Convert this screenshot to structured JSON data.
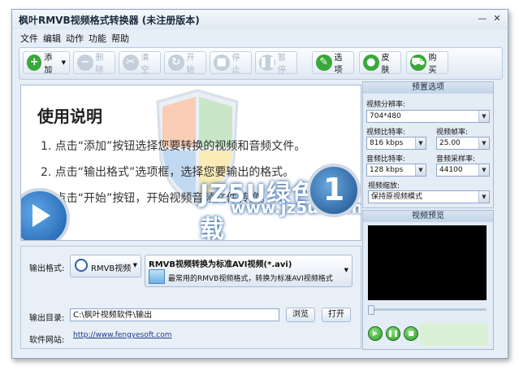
{
  "window": {
    "title": "枫叶RMVB视频格式转换器  (未注册版本)"
  },
  "menu": [
    "文件",
    "编辑",
    "动作",
    "功能",
    "帮助"
  ],
  "toolbar": {
    "add": "添加",
    "delete": "删除",
    "clear": "清空",
    "start": "开始",
    "stop": "停止",
    "pause": "暂停",
    "options": "选项",
    "skin": "皮肤",
    "buy": "购买"
  },
  "guide": {
    "title": "使用说明",
    "steps": [
      "1. 点击“添加”按钮选择您要转换的视频和音频文件。",
      "2. 点击“输出格式”选项框，选择您要输出的格式。",
      "3. 点击“开始”按钮，开始视频音频文件转换。"
    ],
    "watermark_top": "JZ5U绿色下载",
    "watermark_bottom": "www.jz5u.com",
    "step_number": "1"
  },
  "output": {
    "format_label": "输出格式:",
    "format_button": "RMVB视频",
    "format_title": "RMVB视频转换为标准AVI视频(*.avi)",
    "format_desc": "最常用的RMVB视频格式，转换为标准AVI视频格式",
    "dir_label": "输出目录:",
    "dir_value": "C:\\枫叶视频软件\\输出",
    "browse": "浏览",
    "open": "打开",
    "site_label": "软件网站:",
    "site_url": "http://www.fengyesoft.com"
  },
  "preset": {
    "header": "预置选项",
    "resolution_label": "视频分辨率:",
    "resolution": "704*480",
    "vbitrate_label": "视频比特率:",
    "vbitrate": "816 kbps",
    "framerate_label": "视频帧率:",
    "framerate": "25.00",
    "abitrate_label": "音频比特率:",
    "abitrate": "128 kbps",
    "samplerate_label": "音频采样率:",
    "samplerate": "44100",
    "scale_label": "视频缩放:",
    "scale": "保持原视频模式"
  },
  "preview": {
    "header": "视频预览"
  }
}
